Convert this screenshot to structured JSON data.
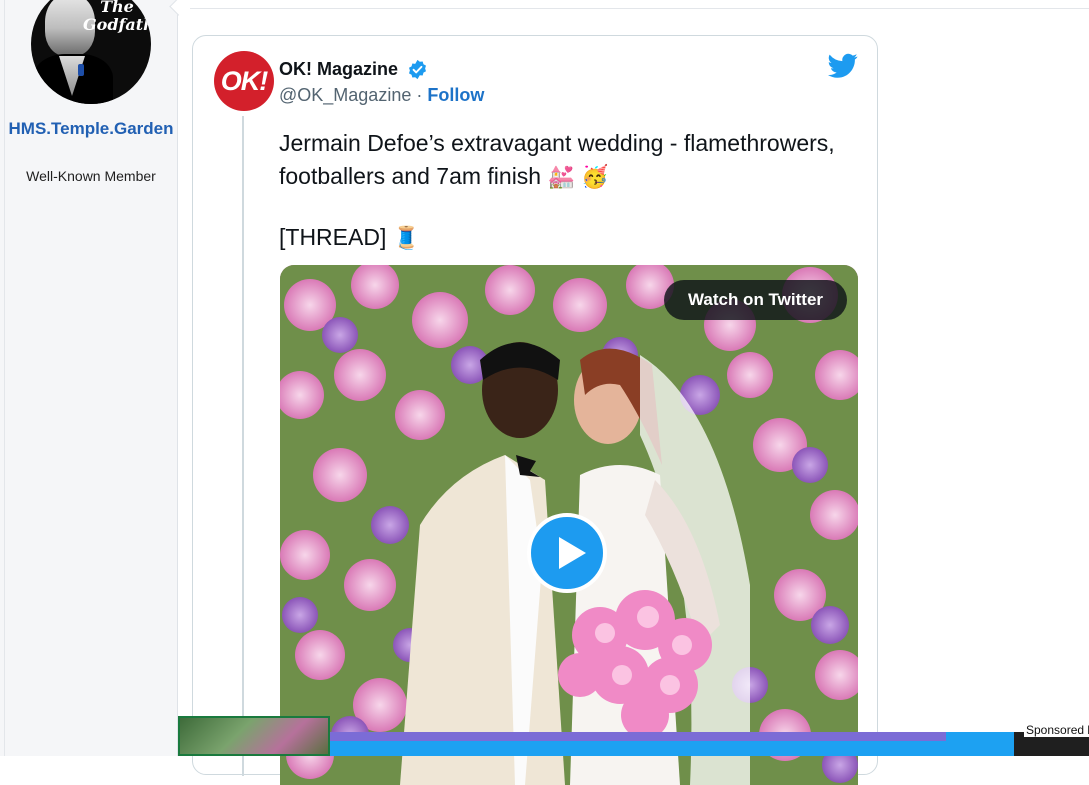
{
  "user": {
    "name": "HMS.Temple.Garden",
    "title": "Well-Known Member",
    "avatar_text": "The Godfather"
  },
  "tweet": {
    "account_name": "OK! Magazine",
    "logo_text": "OK!",
    "handle": "@OK_Magazine",
    "separator": "·",
    "follow_label": "Follow",
    "text_line1": "Jermain Defoe’s extravagant wedding - flamethrowers, footballers and 7am finish",
    "emoji1": "💒",
    "emoji2": "🥳",
    "thread_label": "[THREAD]",
    "thread_emoji": "🧵",
    "watch_label": "Watch on Twitter",
    "brand_blue": "#1d9bf0",
    "ok_red": "#d3202b"
  },
  "ad": {
    "sponsored_label": "Sponsored b"
  }
}
